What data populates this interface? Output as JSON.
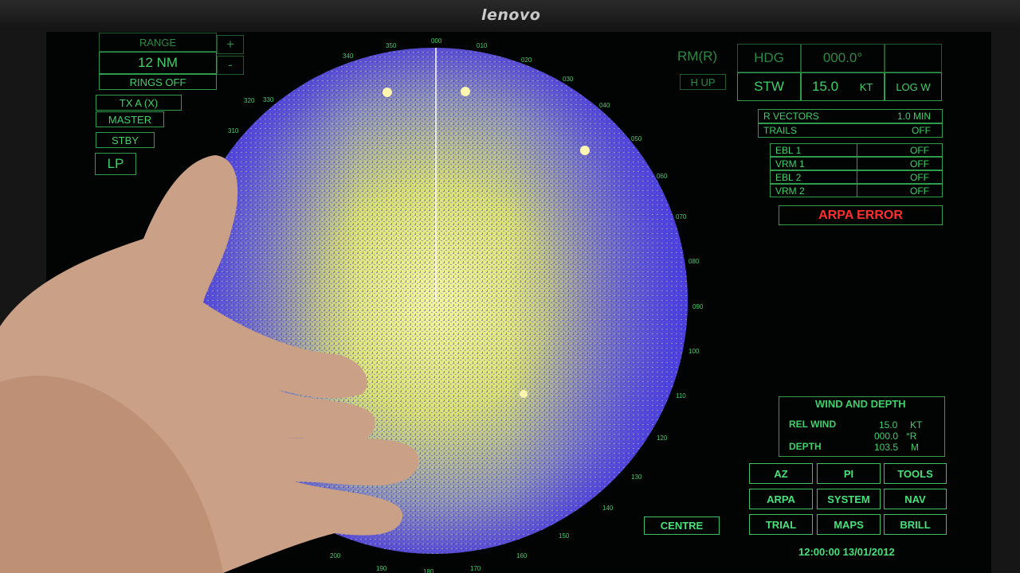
{
  "monitor": {
    "brand": "lenovo"
  },
  "range_panel": {
    "title": "RANGE",
    "value": "12 NM",
    "plus": "+",
    "minus": "-",
    "rings": "RINGS OFF"
  },
  "tx_panel": {
    "tx": "TX A (X)",
    "master": "MASTER",
    "stby": "STBY",
    "lp": "LP"
  },
  "mode_panel": {
    "motion": "RM(R)",
    "orientation": "H UP"
  },
  "heading_panel": {
    "hdg_label": "HDG",
    "hdg_value": "000.0°",
    "stw_label": "STW",
    "stw_value": "15.0",
    "stw_unit": "KT",
    "log": "LOG W"
  },
  "vectors_panel": {
    "rows": [
      {
        "label": "R VECTORS",
        "value": "1.0  MIN"
      },
      {
        "label": "TRAILS",
        "value": "OFF"
      }
    ]
  },
  "ebl_vrm": {
    "rows": [
      {
        "label": "EBL 1",
        "value": "OFF"
      },
      {
        "label": "VRM 1",
        "value": "OFF"
      },
      {
        "label": "EBL 2",
        "value": "OFF"
      },
      {
        "label": "VRM 2",
        "value": "OFF"
      }
    ]
  },
  "alarm": {
    "text": "ARPA ERROR",
    "color": "#ff2e2e"
  },
  "wind_depth": {
    "title": "WIND AND DEPTH",
    "rel_wind_label": "REL WIND",
    "rel_wind_speed": "15.0",
    "rel_wind_speed_unit": "KT",
    "rel_wind_dir": "000.0",
    "rel_wind_dir_unit": "°R",
    "depth_label": "DEPTH",
    "depth_value": "103.5",
    "depth_unit": "M"
  },
  "menu_buttons": [
    "AZ",
    "PI",
    "TOOLS",
    "ARPA",
    "SYSTEM",
    "NAV",
    "TRIAL",
    "MAPS",
    "BRILL"
  ],
  "centre_button": "CENTRE",
  "clock": "12:00:00 13/01/2012",
  "bearing_labels": {
    "top": [
      "340",
      "350",
      "000",
      "010",
      "020",
      "030"
    ],
    "left": [
      "330",
      "320",
      "310"
    ],
    "right": [
      "040",
      "050",
      "060",
      "070",
      "080",
      "090",
      "100",
      "110",
      "120",
      "130",
      "140",
      "150"
    ],
    "bottom": [
      "200",
      "190",
      "180",
      "170",
      "160"
    ]
  },
  "colors": {
    "accent": "#3fcf6a",
    "echo_yellow": "#d7e27a",
    "clutter_blue": "#4a3fd8",
    "background": "#020403"
  }
}
